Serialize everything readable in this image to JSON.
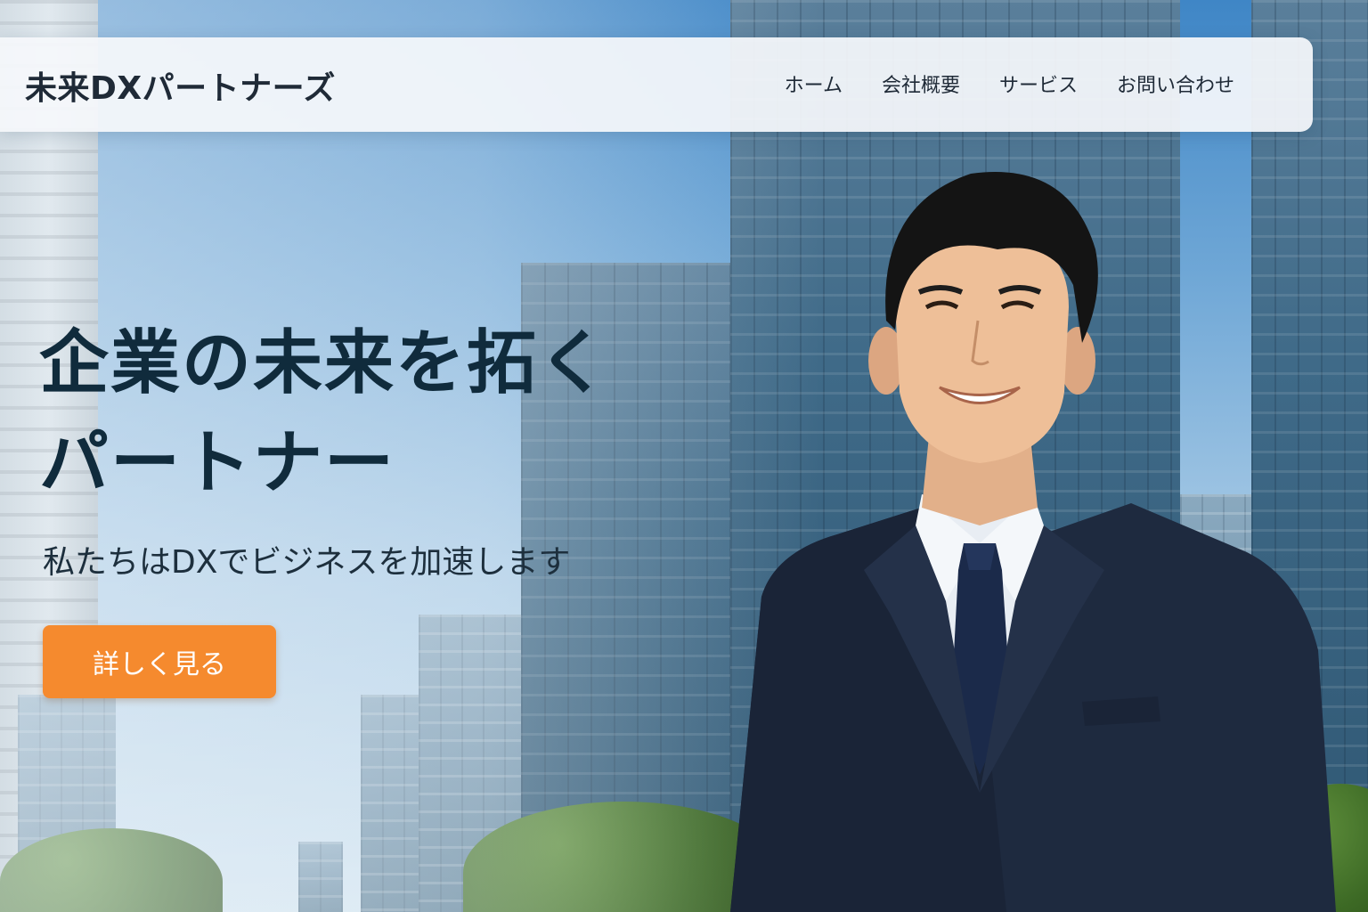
{
  "site": {
    "brand": "未来DXパートナーズ"
  },
  "nav": {
    "items": [
      {
        "label": "ホーム"
      },
      {
        "label": "会社概要"
      },
      {
        "label": "サービス"
      },
      {
        "label": "お問い合わせ"
      }
    ]
  },
  "hero": {
    "title_line1": "企業の未来を拓く",
    "title_line2": "パートナー",
    "subtitle": "私たちはDXでビジネスを加速します",
    "cta_label": "詳しく見る"
  },
  "colors": {
    "accent": "#f58a2e",
    "heading": "#102b3c",
    "text": "#1f2a37",
    "navbar_bg": "#f5f8fb"
  }
}
